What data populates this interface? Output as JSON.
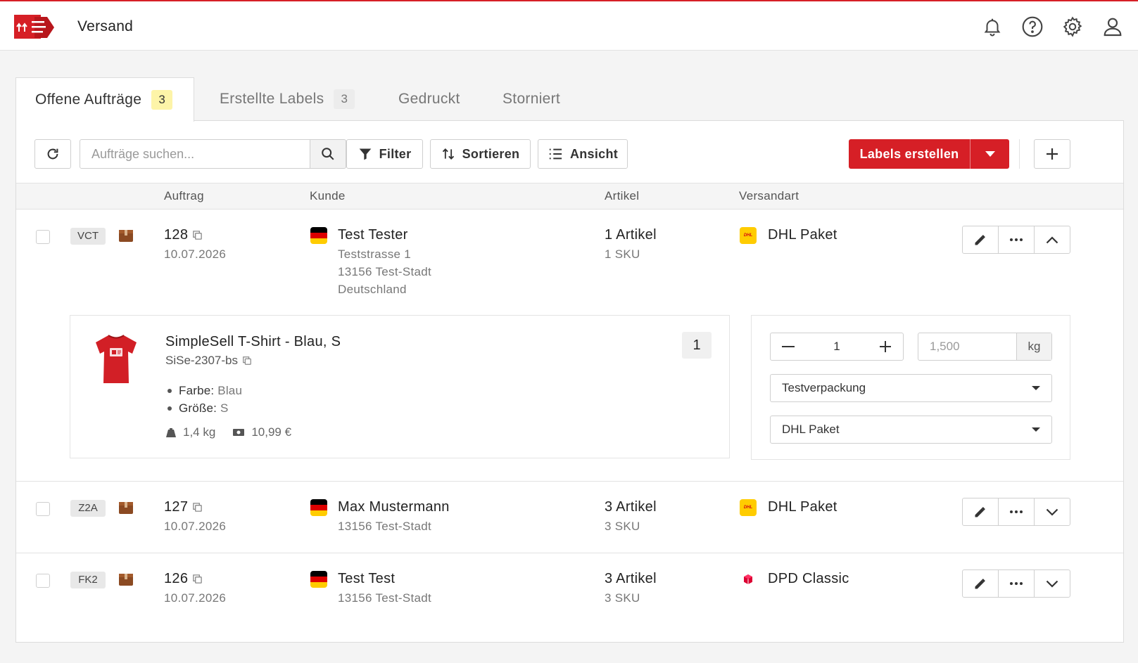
{
  "app": {
    "title": "Versand"
  },
  "header_icons": [
    "bell-icon",
    "help-icon",
    "gear-icon",
    "user-icon"
  ],
  "brand_color": "#d61f26",
  "tabs": [
    {
      "label": "Offene Aufträge",
      "count": "3",
      "active": true
    },
    {
      "label": "Erstellte Labels",
      "count": "3",
      "active": false
    },
    {
      "label": "Gedruckt",
      "active": false
    },
    {
      "label": "Storniert",
      "active": false
    }
  ],
  "toolbar": {
    "search_placeholder": "Aufträge suchen...",
    "filter_label": "Filter",
    "sort_label": "Sortieren",
    "view_label": "Ansicht",
    "create_labels_label": "Labels erstellen"
  },
  "table": {
    "headers": {
      "order": "Auftrag",
      "customer": "Kunde",
      "articles": "Artikel",
      "shipping": "Versandart"
    }
  },
  "orders": [
    {
      "code": "VCT",
      "number": "128",
      "date": "10.07.2026",
      "customer_name": "Test Tester",
      "address_lines": [
        "Teststrasse 1",
        "13156 Test-Stadt",
        "Deutschland"
      ],
      "articles": "1 Artikel",
      "skus": "1 SKU",
      "carrier": "DHL Paket",
      "carrier_type": "dhl",
      "expanded": true
    },
    {
      "code": "Z2A",
      "number": "127",
      "date": "10.07.2026",
      "customer_name": "Max Mustermann",
      "address_lines": [
        "13156 Test-Stadt"
      ],
      "articles": "3 Artikel",
      "skus": "3 SKU",
      "carrier": "DHL Paket",
      "carrier_type": "dhl",
      "expanded": false
    },
    {
      "code": "FK2",
      "number": "126",
      "date": "10.07.2026",
      "customer_name": "Test Test",
      "address_lines": [
        "13156 Test-Stadt"
      ],
      "articles": "3 Artikel",
      "skus": "3 SKU",
      "carrier": "DPD Classic",
      "carrier_type": "dpd",
      "expanded": false
    }
  ],
  "expanded": {
    "product": {
      "name": "SimpleSell T-Shirt - Blau, S",
      "sku": "SiSe-2307-bs",
      "quantity": "1",
      "attributes": [
        {
          "key": "Farbe:",
          "value": "Blau"
        },
        {
          "key": "Größe:",
          "value": "S"
        }
      ],
      "weight": "1,4 kg",
      "price": "10,99 €"
    },
    "config": {
      "package_count": "1",
      "weight_placeholder": "1,500",
      "weight_unit": "kg",
      "packaging": "Testverpackung",
      "shipping_method": "DHL Paket"
    }
  }
}
